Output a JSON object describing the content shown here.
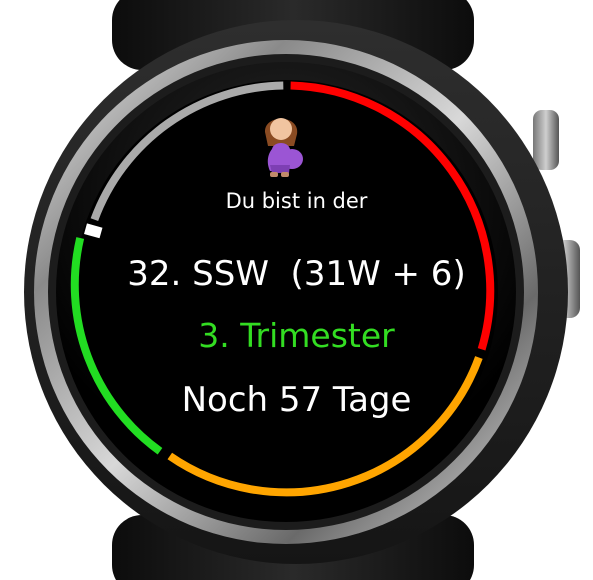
{
  "watch": {
    "intro_text": "Du bist in der",
    "week_text": "32. SSW  (31W + 6)",
    "trimester_text": "3. Trimester",
    "remaining_text": "Noch 57 Tage"
  },
  "icons": {
    "top": "pregnant-woman-icon"
  },
  "colors": {
    "background": "#000000",
    "trimester_text": "#33dd22",
    "ring_trimester_1": "#aaaaaa",
    "ring_trimester_2": "#ff0000",
    "ring_trimester_3": "#ffa500",
    "ring_current": "#22dd22",
    "marker": "#ffffff"
  }
}
